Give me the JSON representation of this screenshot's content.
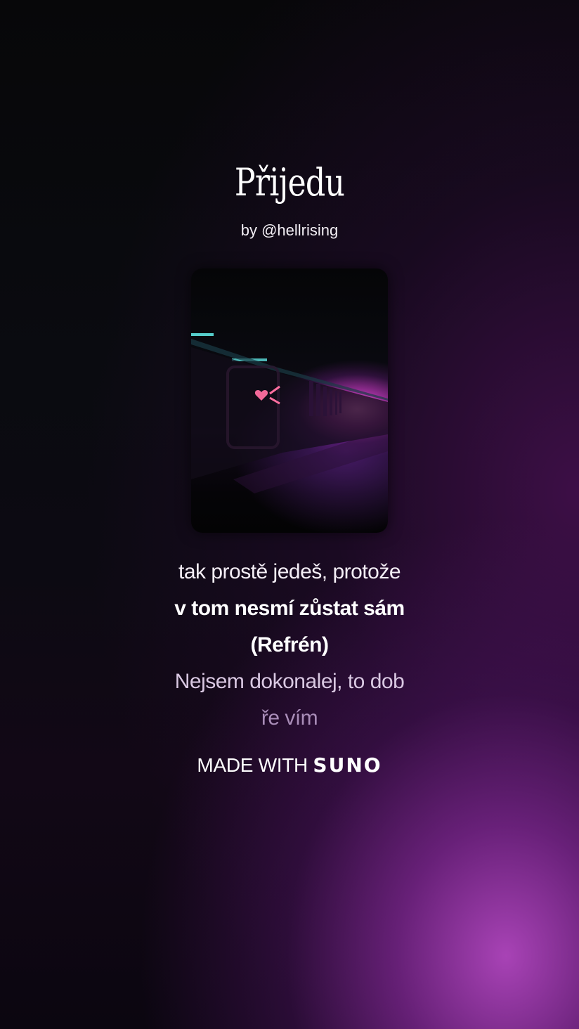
{
  "song": {
    "title": "Přijedu",
    "byline": "by @hellrising"
  },
  "lyrics": {
    "line1": "tak prostě jedeš, protože",
    "line2": "v tom nesmí zůstat sám",
    "line3": "(Refrén)",
    "line4": "Nejsem dokonalej, to dob",
    "line5": "ře vím"
  },
  "footer": {
    "made_with": "MADE WITH",
    "brand": "SUNO"
  },
  "colors": {
    "accent_glow": "#b046be",
    "text": "#ffffff"
  }
}
